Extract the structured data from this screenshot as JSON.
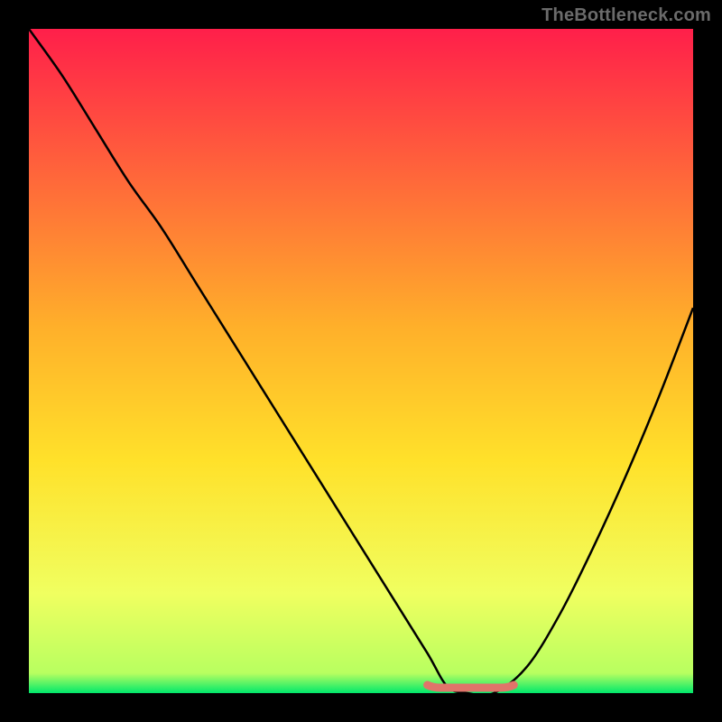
{
  "watermark": "TheBottleneck.com",
  "colors": {
    "top": "#ff1f4a",
    "mid_upper": "#ff8a2a",
    "mid": "#ffe12a",
    "mid_lower": "#f6ff60",
    "bottom": "#00e86b",
    "curve": "#000000",
    "marker": "#e0746a",
    "frame": "#000000"
  },
  "chart_data": {
    "type": "line",
    "title": "",
    "xlabel": "",
    "ylabel": "",
    "xlim": [
      0,
      100
    ],
    "ylim": [
      0,
      100
    ],
    "series": [
      {
        "name": "bottleneck-curve",
        "x": [
          0,
          5,
          10,
          15,
          20,
          25,
          30,
          35,
          40,
          45,
          50,
          55,
          60,
          63,
          66,
          70,
          75,
          80,
          85,
          90,
          95,
          100
        ],
        "y": [
          100,
          93,
          85,
          77,
          70,
          62,
          54,
          46,
          38,
          30,
          22,
          14,
          6,
          1,
          0,
          0,
          4,
          12,
          22,
          33,
          45,
          58
        ]
      }
    ],
    "optimal_range": {
      "x_start": 60,
      "x_end": 73,
      "y": 0
    },
    "gradient_stops": [
      {
        "pct": 0,
        "color": "#ff1f4a"
      },
      {
        "pct": 45,
        "color": "#ffb02a"
      },
      {
        "pct": 65,
        "color": "#ffe12a"
      },
      {
        "pct": 85,
        "color": "#f0ff60"
      },
      {
        "pct": 97,
        "color": "#b8ff60"
      },
      {
        "pct": 100,
        "color": "#00e86b"
      }
    ]
  }
}
